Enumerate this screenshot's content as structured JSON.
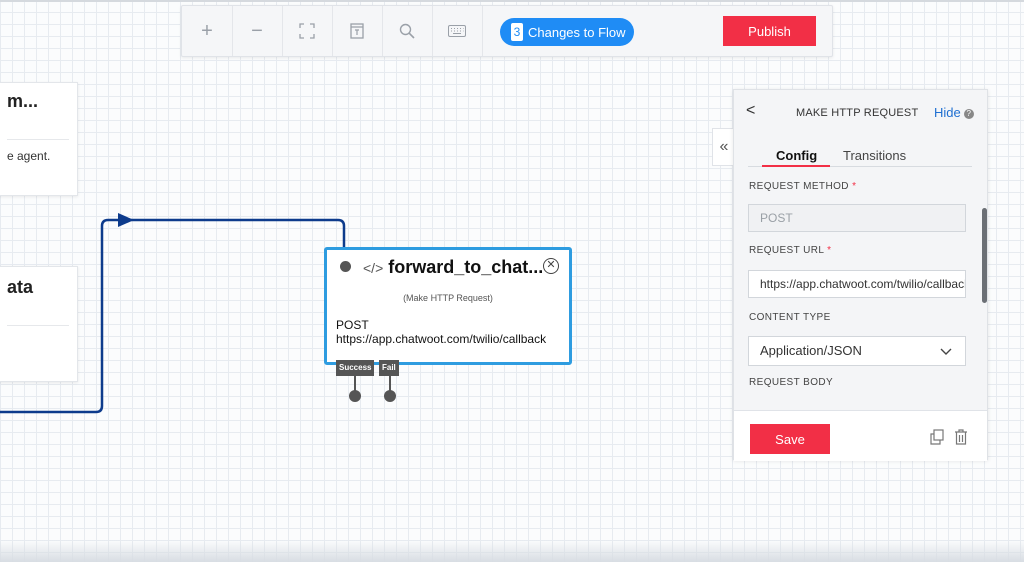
{
  "toolbar": {
    "buttons": [
      {
        "name": "zoom-in",
        "glyph": "+"
      },
      {
        "name": "zoom-out",
        "glyph": "−"
      },
      {
        "name": "fit-to-screen",
        "glyph": "⛶"
      },
      {
        "name": "notes",
        "glyph": "▣"
      },
      {
        "name": "search",
        "glyph": "⌕"
      },
      {
        "name": "keyboard",
        "glyph": "⌨"
      }
    ],
    "changes_count": "3",
    "changes_label": "Changes to Flow",
    "publish_label": "Publish"
  },
  "left_cards": [
    {
      "title": "m...",
      "text": "e agent."
    },
    {
      "title": "ata",
      "text": ""
    }
  ],
  "widget": {
    "code_glyph": "</>",
    "title": "forward_to_chat...",
    "subtitle": "(Make HTTP Request)",
    "method": "POST",
    "url": "https://app.chatwoot.com/twilio/callback",
    "ports": [
      "Success",
      "Fail"
    ],
    "close_glyph": "✕"
  },
  "panel": {
    "back_glyph": "<",
    "title": "MAKE HTTP REQUEST",
    "hide_label": "Hide",
    "help_glyph": "?",
    "collapse_glyph": "«",
    "tabs": [
      "Config",
      "Transitions"
    ],
    "active_tab": "Config",
    "fields": {
      "request_method": {
        "label": "REQUEST METHOD",
        "required": "*",
        "value": "POST"
      },
      "request_url": {
        "label": "REQUEST URL",
        "required": "*",
        "value": "https://app.chatwoot.com/twilio/callback"
      },
      "content_type": {
        "label": "CONTENT TYPE",
        "value": "Application/JSON"
      },
      "request_body": {
        "label": "REQUEST BODY"
      }
    },
    "save_label": "Save"
  },
  "colors": {
    "accent_red": "#f22f46",
    "accent_blue": "#1f8cf5",
    "widget_border": "#2e9ce0",
    "connector": "#0d3b8c"
  }
}
